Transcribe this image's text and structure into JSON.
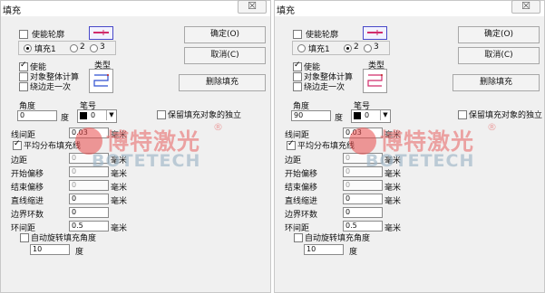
{
  "panels": [
    {
      "title": "填充",
      "close_glyph": "☒",
      "enable_outline": "使能轮廓",
      "confirm": "确定(O)",
      "cancel": "取消(C)",
      "delete_fill": "删除填充",
      "fill1": "填充1",
      "fill2": "2",
      "fill3": "3",
      "enable": "使能",
      "whole_calc": "对象整体计算",
      "walk_once": "绕边走一次",
      "type": "类型",
      "angle_label": "角度",
      "angle_value": "0",
      "deg": "度",
      "pen_label": "笔号",
      "pen_value": "0",
      "keep_independent": "保留填充对象的独立",
      "line_spacing_label": "线间距",
      "line_spacing_value": "0.03",
      "mm": "毫米",
      "avg_distribute": "平均分布填充线",
      "margin_label": "边距",
      "margin_value": "0",
      "start_offset_label": "开始偏移",
      "start_offset_value": "0",
      "end_offset_label": "结束偏移",
      "end_offset_value": "0",
      "line_indent_label": "直线缩进",
      "line_indent_value": "0",
      "border_loops_label": "边界环数",
      "border_loops_value": "0",
      "loop_spacing_label": "环间距",
      "loop_spacing_value": "0.5",
      "auto_rotate": "自动旋转填充角度",
      "rotate_value": "10",
      "rotate_unit": "度",
      "fill_selected": 1,
      "enable_outline_checked": false,
      "enable_checked": true,
      "avg_checked": true,
      "whole_calc_checked": false,
      "walk_once_checked": false,
      "keep_checked": false,
      "auto_rotate_checked": false
    },
    {
      "title": "填充",
      "close_glyph": "☒",
      "enable_outline": "使能轮廓",
      "confirm": "确定(O)",
      "cancel": "取消(C)",
      "delete_fill": "删除填充",
      "fill1": "填充1",
      "fill2": "2",
      "fill3": "3",
      "enable": "使能",
      "whole_calc": "对象整体计算",
      "walk_once": "绕边走一次",
      "type": "类型",
      "angle_label": "角度",
      "angle_value": "90",
      "deg": "度",
      "pen_label": "笔号",
      "pen_value": "0",
      "keep_independent": "保留填充对象的独立",
      "line_spacing_label": "线间距",
      "line_spacing_value": "0.03",
      "mm": "毫米",
      "avg_distribute": "平均分布填充线",
      "margin_label": "边距",
      "margin_value": "0",
      "start_offset_label": "开始偏移",
      "start_offset_value": "0",
      "end_offset_label": "结束偏移",
      "end_offset_value": "0",
      "line_indent_label": "直线缩进",
      "line_indent_value": "0",
      "border_loops_label": "边界环数",
      "border_loops_value": "0",
      "loop_spacing_label": "环间距",
      "loop_spacing_value": "0.5",
      "auto_rotate": "自动旋转填充角度",
      "rotate_value": "10",
      "rotate_unit": "度",
      "fill_selected": 2,
      "enable_outline_checked": false,
      "enable_checked": true,
      "avg_checked": true,
      "whole_calc_checked": false,
      "walk_once_checked": false,
      "keep_checked": false,
      "auto_rotate_checked": false
    }
  ],
  "watermark": {
    "cn": "博特激光",
    "en": "BOTETECH",
    "reg": "®"
  },
  "colors": {
    "panel_bg": "#f0f0f0",
    "watermark_red": "#e86d6d",
    "watermark_blue": "#9fb7c8",
    "outline_icon": "#d12c6b",
    "fill_icon": "#2f4fd0"
  }
}
